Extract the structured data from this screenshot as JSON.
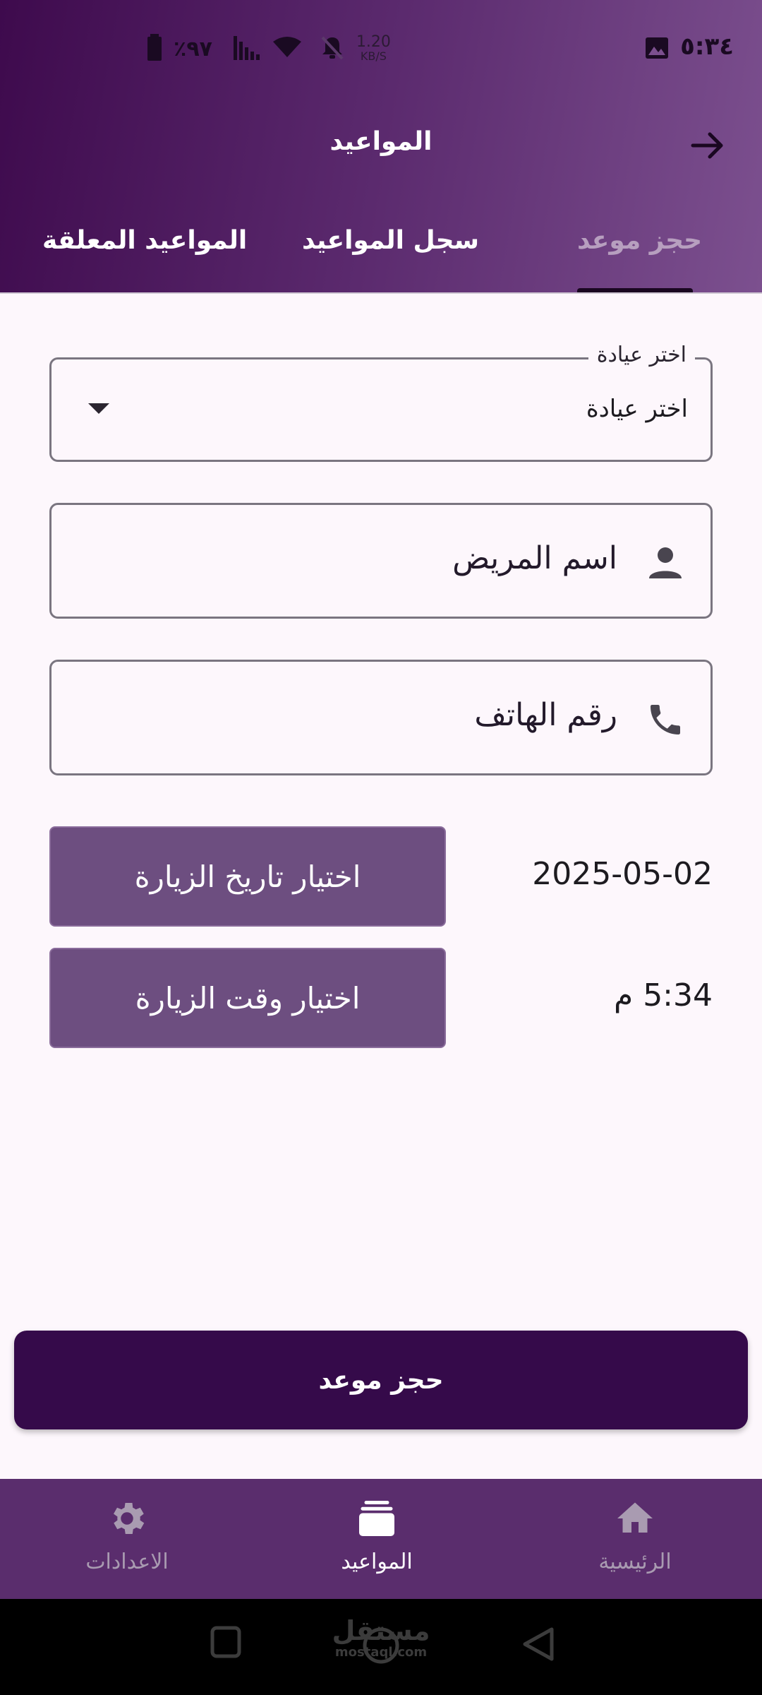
{
  "status_bar": {
    "time": "٥:٣٤",
    "battery": "٪٩٧",
    "net_speed_value": "1.20",
    "net_speed_unit": "KB/S"
  },
  "header": {
    "title": "المواعيد"
  },
  "tabs": [
    {
      "label": "حجز موعد",
      "active": true
    },
    {
      "label": "سجل المواعيد",
      "active": false
    },
    {
      "label": "المواعيد المعلقة",
      "active": false
    }
  ],
  "form": {
    "clinic_select": {
      "legend": "اختر عيادة",
      "value": "اختر عيادة"
    },
    "patient_name": {
      "placeholder": "اسم المريض"
    },
    "phone": {
      "placeholder": "رقم الهاتف"
    },
    "date": {
      "button_label": "اختيار تاريخ الزيارة",
      "value": "2025-05-02"
    },
    "time": {
      "button_label": "اختيار وقت الزيارة",
      "value": "5:34 م"
    }
  },
  "book_button": "حجز موعد",
  "bottom_nav": [
    {
      "label": "الرئيسية",
      "icon": "home-icon",
      "active": false
    },
    {
      "label": "المواعيد",
      "icon": "appointments-icon",
      "active": true
    },
    {
      "label": "الاعدادات",
      "icon": "settings-icon",
      "active": false
    }
  ],
  "watermark": {
    "arabic": "مستقل",
    "latin": "mostaql.com"
  },
  "colors": {
    "header_start": "#3e0a4d",
    "header_end": "#7c508f",
    "button": "#6d4e80",
    "primary": "#350a4a",
    "nav_bg": "#5a2d6d",
    "background": "#fdf7fc"
  }
}
